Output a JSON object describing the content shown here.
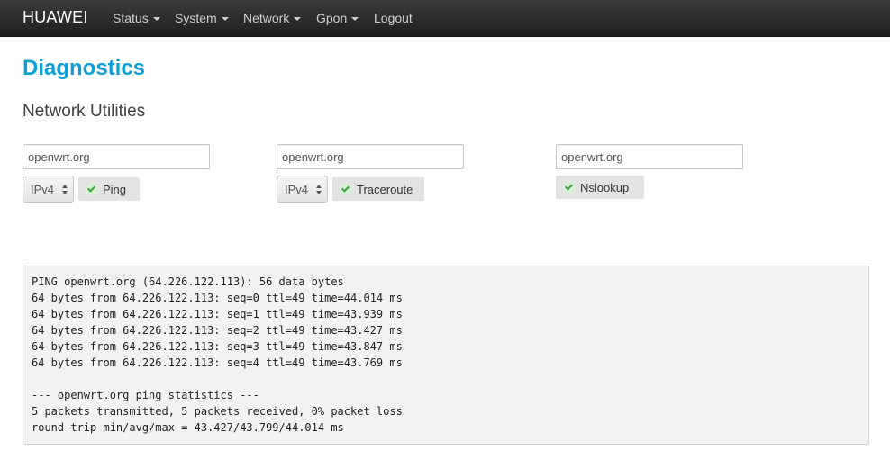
{
  "navbar": {
    "brand": "HUAWEI",
    "menus": [
      {
        "label": "Status",
        "dropdown": true
      },
      {
        "label": "System",
        "dropdown": true
      },
      {
        "label": "Network",
        "dropdown": true
      },
      {
        "label": "Gpon",
        "dropdown": true
      },
      {
        "label": "Logout",
        "dropdown": false
      }
    ]
  },
  "page": {
    "title": "Diagnostics",
    "subtitle": "Network Utilities"
  },
  "tools": {
    "ping": {
      "host_value": "openwrt.org",
      "protocol": "IPv4",
      "button_label": "Ping"
    },
    "traceroute": {
      "host_value": "openwrt.org",
      "protocol": "IPv4",
      "button_label": "Traceroute"
    },
    "nslookup": {
      "host_value": "openwrt.org",
      "button_label": "Nslookup"
    }
  },
  "icons": {
    "button_check": "check-circle-icon",
    "select_arrows": "up-down-arrows-icon",
    "menu_caret": "caret-down-icon"
  },
  "colors": {
    "navbar_bg": "#2b2b2b",
    "title": "#0d9fd6",
    "check": "#3fa33f",
    "output_bg": "#f2f2f2"
  },
  "output": {
    "lines": [
      "PING openwrt.org (64.226.122.113): 56 data bytes",
      "64 bytes from 64.226.122.113: seq=0 ttl=49 time=44.014 ms",
      "64 bytes from 64.226.122.113: seq=1 ttl=49 time=43.939 ms",
      "64 bytes from 64.226.122.113: seq=2 ttl=49 time=43.427 ms",
      "64 bytes from 64.226.122.113: seq=3 ttl=49 time=43.847 ms",
      "64 bytes from 64.226.122.113: seq=4 ttl=49 time=43.769 ms",
      "",
      "--- openwrt.org ping statistics ---",
      "5 packets transmitted, 5 packets received, 0% packet loss",
      "round-trip min/avg/max = 43.427/43.799/44.014 ms"
    ]
  }
}
